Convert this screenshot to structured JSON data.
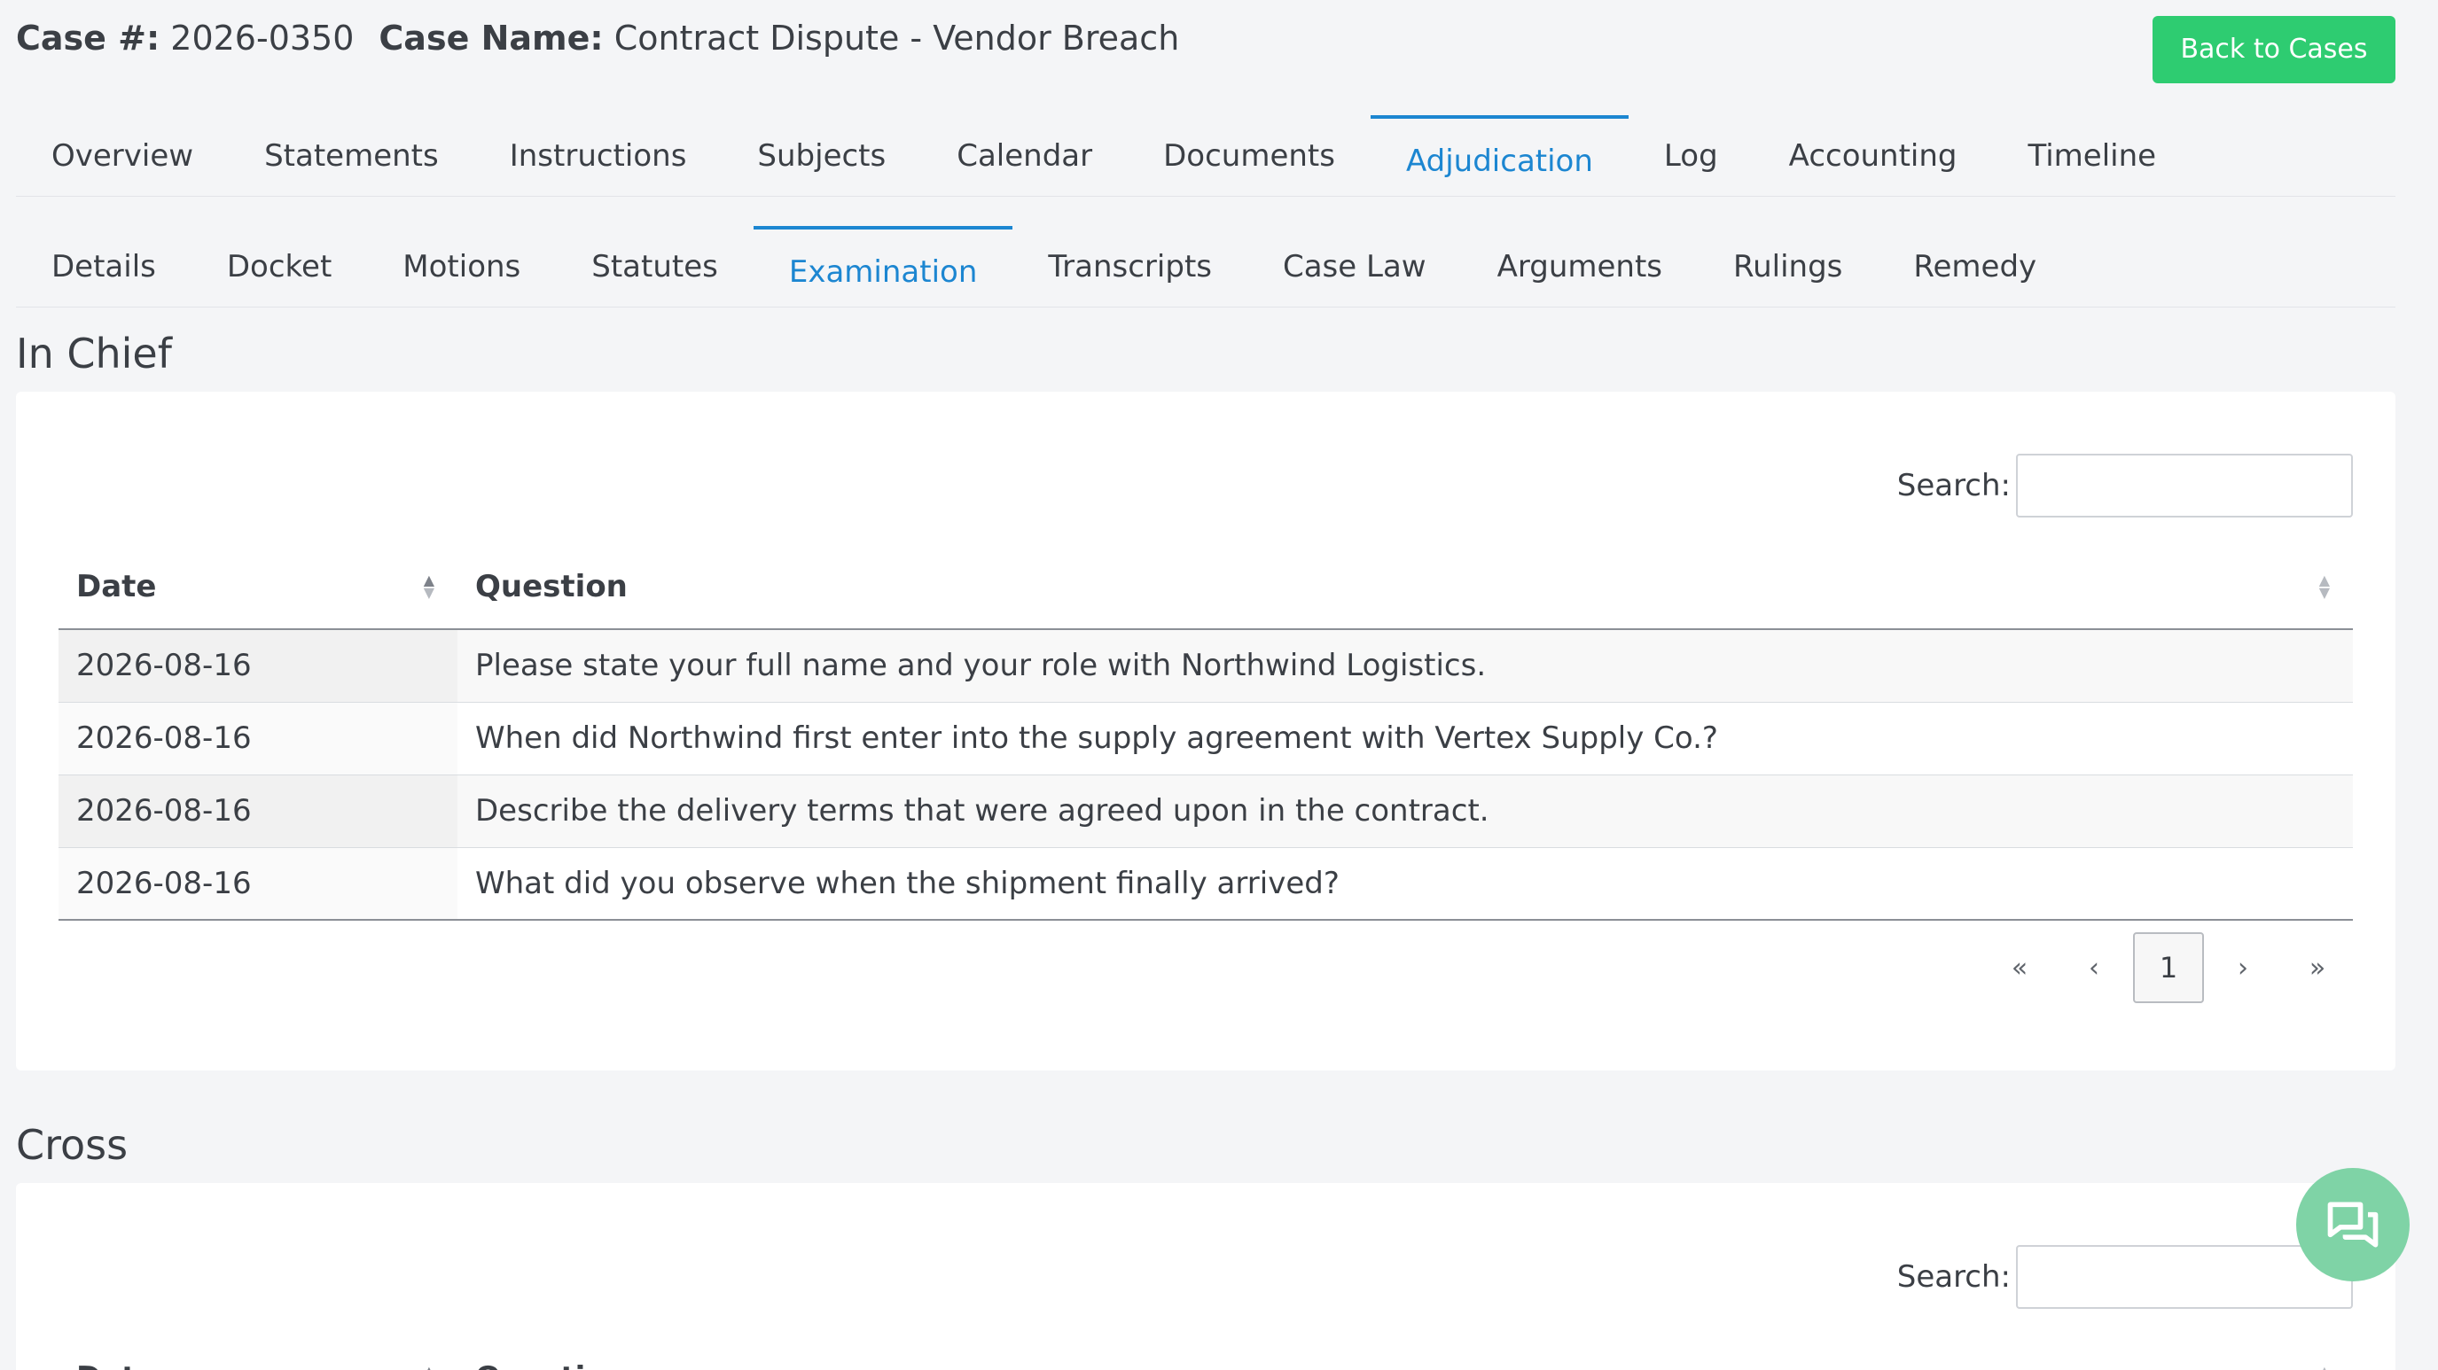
{
  "header": {
    "case_number_label": "Case #:",
    "case_number": "2026-0350",
    "case_name_label": "Case Name:",
    "case_name": "Contract Dispute - Vendor Breach",
    "back_button": "Back to Cases"
  },
  "primary_tabs": [
    {
      "label": "Overview",
      "active": false
    },
    {
      "label": "Statements",
      "active": false
    },
    {
      "label": "Instructions",
      "active": false
    },
    {
      "label": "Subjects",
      "active": false
    },
    {
      "label": "Calendar",
      "active": false
    },
    {
      "label": "Documents",
      "active": false
    },
    {
      "label": "Adjudication",
      "active": true
    },
    {
      "label": "Log",
      "active": false
    },
    {
      "label": "Accounting",
      "active": false
    },
    {
      "label": "Timeline",
      "active": false
    }
  ],
  "secondary_tabs": [
    {
      "label": "Details",
      "active": false
    },
    {
      "label": "Docket",
      "active": false
    },
    {
      "label": "Motions",
      "active": false
    },
    {
      "label": "Statutes",
      "active": false
    },
    {
      "label": "Examination",
      "active": true
    },
    {
      "label": "Transcripts",
      "active": false
    },
    {
      "label": "Case Law",
      "active": false
    },
    {
      "label": "Arguments",
      "active": false
    },
    {
      "label": "Rulings",
      "active": false
    },
    {
      "label": "Remedy",
      "active": false
    }
  ],
  "in_chief": {
    "title": "In Chief",
    "search_label": "Search:",
    "search_value": "",
    "columns": {
      "date": "Date",
      "question": "Question"
    },
    "rows": [
      {
        "date": "2026-08-16",
        "question": "Please state your full name and your role with Northwind Logistics."
      },
      {
        "date": "2026-08-16",
        "question": "When did Northwind first enter into the supply agreement with Vertex Supply Co.?"
      },
      {
        "date": "2026-08-16",
        "question": "Describe the delivery terms that were agreed upon in the contract."
      },
      {
        "date": "2026-08-16",
        "question": "What did you observe when the shipment finally arrived?"
      }
    ],
    "pagination": {
      "first": "«",
      "prev": "‹",
      "current": "1",
      "next": "›",
      "last": "»"
    }
  },
  "cross": {
    "title": "Cross",
    "search_label": "Search:",
    "search_value": "",
    "columns": {
      "date": "Date",
      "question": "Question"
    }
  },
  "colors": {
    "accent": "#1c86d1",
    "back_button": "#2ecc71",
    "chat_button": "#7fd3a6"
  },
  "icons": {
    "sort_both": "sort-both-icon",
    "chat": "chat-icon"
  }
}
